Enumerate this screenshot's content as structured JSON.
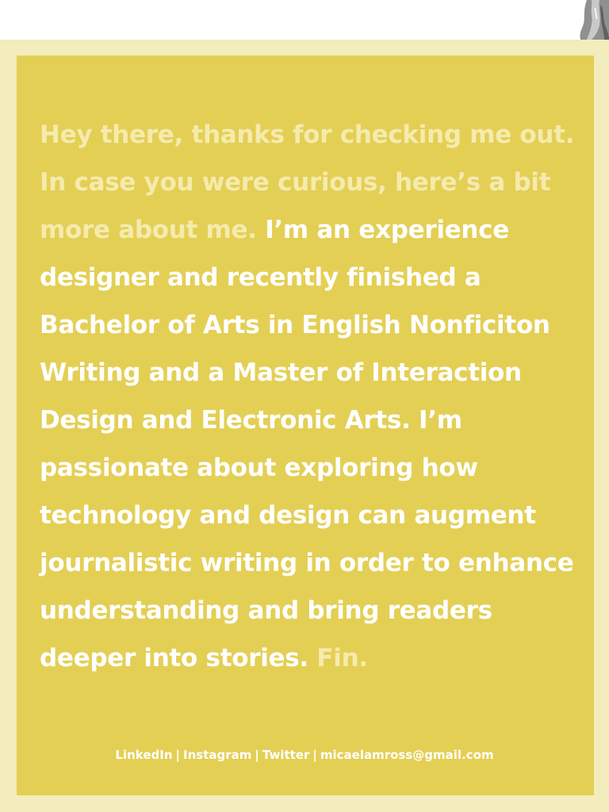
{
  "bio": {
    "intro": "Hey there, thanks for checking me out. In case you were curious, here’s a bit more about me.",
    "body": "I’m an experience designer and recently finished a Bachelor of Arts in English Nonficiton Writing and a Master of Interaction Design and Electronic Arts. I’m passionate about exploring how technology and design can augment journalistic writing in order to enhance understanding and bring readers deeper into stories.",
    "outro": "Fin."
  },
  "footer": {
    "links": [
      "LinkedIn",
      "Instagram",
      "Twitter",
      "micaelamross@gmail.com"
    ],
    "separator": "|"
  },
  "colors": {
    "card_background": "#e4cf55",
    "frame_background": "#f3ecbc",
    "text_primary": "#ffffff",
    "text_faded": "#f5ebae"
  }
}
